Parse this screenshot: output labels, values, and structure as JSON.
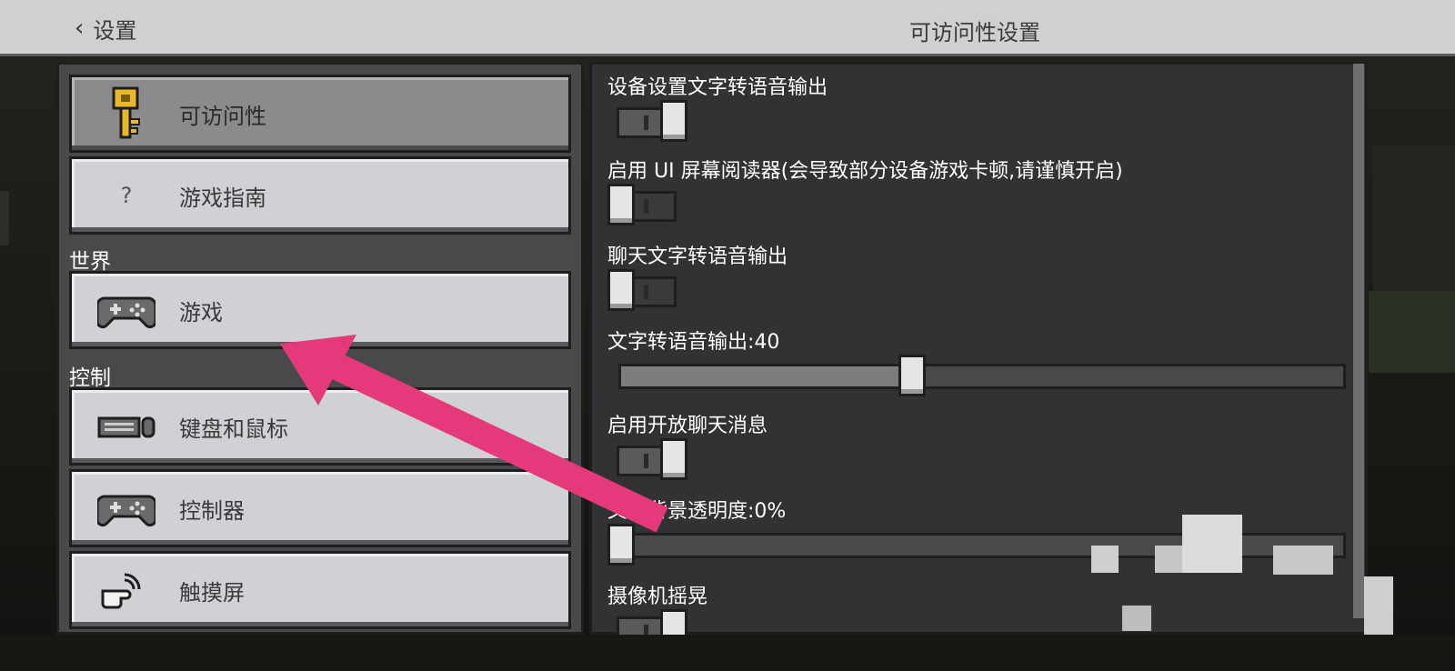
{
  "header": {
    "back_label": "设置",
    "title": "可访问性设置"
  },
  "sidebar": {
    "items_top": [
      {
        "label": "可访问性",
        "icon": "key-icon",
        "selected": true
      },
      {
        "label": "游戏指南",
        "icon": "question-icon",
        "selected": false
      }
    ],
    "section_world": "世界",
    "items_world": [
      {
        "label": "游戏",
        "icon": "controller-icon",
        "selected": false
      }
    ],
    "section_controls": "控制",
    "items_controls": [
      {
        "label": "键盘和鼠标",
        "icon": "keyboard-mouse-icon",
        "selected": false
      },
      {
        "label": "控制器",
        "icon": "controller-icon",
        "selected": false
      },
      {
        "label": "触摸屏",
        "icon": "touch-icon",
        "selected": false
      }
    ],
    "question_glyph": "?"
  },
  "settings": {
    "device_tts_label": "设备设置文字转语音输出",
    "device_tts_on": true,
    "ui_reader_label": "启用 UI 屏幕阅读器(会导致部分设备游戏卡顿,请谨慎开启)",
    "ui_reader_on": false,
    "chat_tts_label": "聊天文字转语音输出",
    "chat_tts_on": false,
    "tts_volume_label": "文字转语音输出:40",
    "tts_volume_value": 40,
    "open_chat_label": "启用开放聊天消息",
    "open_chat_on": true,
    "text_bg_opacity_label": "文本背景透明度:0%",
    "text_bg_opacity_value": 0,
    "camera_shake_label": "摄像机摇晃",
    "camera_shake_on": true
  },
  "colors": {
    "arrow": "#e4397a",
    "panel_button": "#d0d1d4",
    "selected_button": "#8b8b8c",
    "header_bg": "#d0d0d0"
  }
}
